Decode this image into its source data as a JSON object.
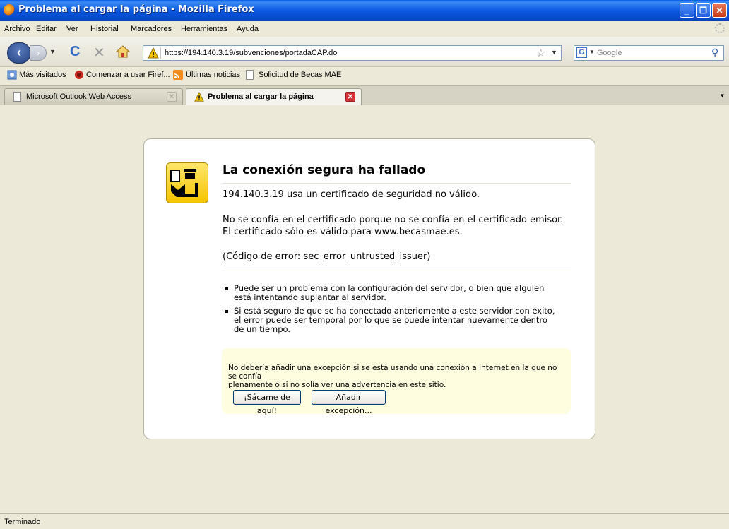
{
  "window": {
    "title": "Problema al cargar la página - Mozilla Firefox"
  },
  "menu": [
    "Archivo",
    "Editar",
    "Ver",
    "Historial",
    "Marcadores",
    "Herramientas",
    "Ayuda"
  ],
  "nav": {
    "url": "https://194.140.3.19/subvenciones/portadaCAP.do",
    "search_placeholder": "Google"
  },
  "bookmarks": [
    "Más visitados",
    "Comenzar a usar Firef...",
    "Últimas noticias",
    "Solicitud de Becas MAE"
  ],
  "tabs": [
    {
      "label": "Microsoft Outlook Web Access"
    },
    {
      "label": "Problema al cargar la página"
    }
  ],
  "error": {
    "title": "La conexión segura ha fallado",
    "line1": "194.140.3.19 usa un certificado de seguridad no válido.",
    "line2": "No se confía en el certificado porque no se confía en el certificado emisor.",
    "line3": "El certificado sólo es válido para www.becasmae.es.",
    "code": "(Código de error: sec_error_untrusted_issuer)",
    "bullet1_a": "Puede ser un problema con la configuración del servidor, o bien que alguien",
    "bullet1_b": "está intentando suplantar al servidor.",
    "bullet2_a": "Si está seguro de que se ha conectado anteriomente a este servidor con éxito,",
    "bullet2_b": "el error puede ser temporal por lo que se puede intentar nuevamente dentro",
    "bullet2_c": "de un tiempo.",
    "advisory_a": "No debería añadir una excepción si se está usando una conexión a Internet en la que no se confía",
    "advisory_b": "plenamente o si no solía ver una advertencia en este sitio.",
    "btn_leave": "¡Sácame de aquí!",
    "btn_exception": "Añadir excepción..."
  },
  "status": {
    "text": "Terminado"
  },
  "colors": {
    "titlebar": "#0b59e0",
    "warning_yellow": "#f4c300",
    "advisory_bg": "#fffde0"
  }
}
